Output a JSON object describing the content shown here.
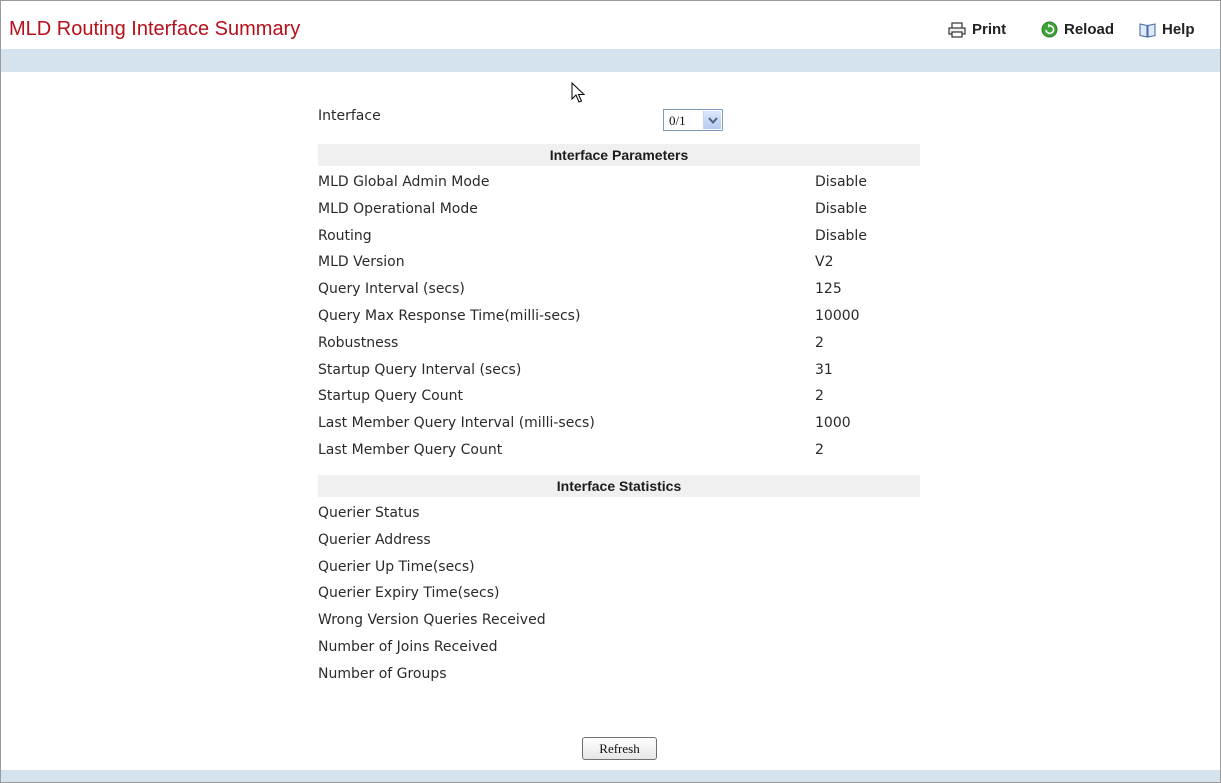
{
  "header": {
    "title": "MLD Routing Interface Summary",
    "print_label": "Print",
    "reload_label": "Reload",
    "help_label": "Help",
    "title_color": "#b8101b",
    "band_color": "#d5e3ee"
  },
  "interface": {
    "label": "Interface",
    "selected": "0/1"
  },
  "parameters": {
    "header": "Interface Parameters",
    "rows": [
      {
        "label": "MLD Global Admin Mode",
        "value": "Disable"
      },
      {
        "label": "MLD Operational Mode",
        "value": "Disable"
      },
      {
        "label": "Routing",
        "value": "Disable"
      },
      {
        "label": "MLD Version",
        "value": "V2"
      },
      {
        "label": "Query Interval (secs)",
        "value": "125"
      },
      {
        "label": "Query Max Response Time(milli-secs)",
        "value": "10000"
      },
      {
        "label": "Robustness",
        "value": "2"
      },
      {
        "label": "Startup Query Interval (secs)",
        "value": "31"
      },
      {
        "label": "Startup Query Count",
        "value": "2"
      },
      {
        "label": "Last Member Query Interval (milli-secs)",
        "value": "1000"
      },
      {
        "label": "Last Member Query Count",
        "value": "2"
      }
    ]
  },
  "statistics": {
    "header": "Interface Statistics",
    "rows": [
      {
        "label": "Querier Status"
      },
      {
        "label": "Querier Address"
      },
      {
        "label": "Querier Up Time(secs)"
      },
      {
        "label": "Querier Expiry Time(secs)"
      },
      {
        "label": "Wrong Version Queries Received"
      },
      {
        "label": "Number of Joins Received"
      },
      {
        "label": "Number of Groups"
      }
    ]
  },
  "actions": {
    "refresh_label": "Refresh"
  },
  "icons": {
    "print": "printer-icon",
    "reload": "reload-icon",
    "help": "help-book-icon",
    "dropdown": "chevron-down-icon",
    "cursor": "mouse-cursor-icon"
  }
}
